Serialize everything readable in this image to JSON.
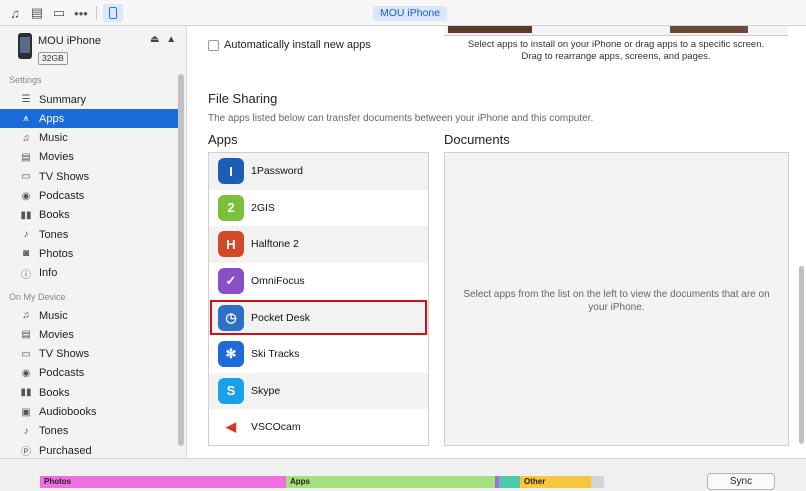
{
  "toolbar": {
    "icons": [
      "music-note-icon",
      "film-icon",
      "tv-icon",
      "more-icon",
      "iphone-icon"
    ],
    "more_label": "•••",
    "device_pill": "MOU iPhone"
  },
  "device": {
    "name": "MOU iPhone",
    "capacity": "32GB",
    "actions": "⏏ ▲"
  },
  "sidebar": {
    "settings_label": "Settings",
    "settings_items": [
      {
        "label": "Summary",
        "icon": "summary-icon",
        "glyph": "☰"
      },
      {
        "label": "Apps",
        "icon": "apps-icon",
        "glyph": "⩚"
      },
      {
        "label": "Music",
        "icon": "music-note-icon",
        "glyph": "♫"
      },
      {
        "label": "Movies",
        "icon": "film-icon",
        "glyph": "▤"
      },
      {
        "label": "TV Shows",
        "icon": "tv-icon",
        "glyph": "▭"
      },
      {
        "label": "Podcasts",
        "icon": "podcast-icon",
        "glyph": "◉"
      },
      {
        "label": "Books",
        "icon": "books-icon",
        "glyph": "▮▮"
      },
      {
        "label": "Tones",
        "icon": "bell-icon",
        "glyph": "♪"
      },
      {
        "label": "Photos",
        "icon": "camera-icon",
        "glyph": "◙"
      },
      {
        "label": "Info",
        "icon": "info-icon",
        "glyph": "ⓘ"
      }
    ],
    "ondevice_label": "On My Device",
    "device_items": [
      {
        "label": "Music",
        "icon": "music-note-icon",
        "glyph": "♫"
      },
      {
        "label": "Movies",
        "icon": "film-icon",
        "glyph": "▤"
      },
      {
        "label": "TV Shows",
        "icon": "tv-icon",
        "glyph": "▭"
      },
      {
        "label": "Podcasts",
        "icon": "podcast-icon",
        "glyph": "◉"
      },
      {
        "label": "Books",
        "icon": "books-icon",
        "glyph": "▮▮"
      },
      {
        "label": "Audiobooks",
        "icon": "audiobook-icon",
        "glyph": "▣"
      },
      {
        "label": "Tones",
        "icon": "bell-icon",
        "glyph": "♪"
      },
      {
        "label": "Purchased",
        "icon": "purchased-icon",
        "glyph": "Ⓟ"
      }
    ],
    "active_index": 1
  },
  "main": {
    "auto_install_label": "Automatically install new apps",
    "screens_hint_line1": "Select apps to install on your iPhone or drag apps to a specific screen.",
    "screens_hint_line2": "Drag to rearrange apps, screens, and pages.",
    "file_sharing_title": "File Sharing",
    "file_sharing_desc": "The apps listed below can transfer documents between your iPhone and this computer.",
    "apps_header": "Apps",
    "documents_header": "Documents",
    "apps": [
      {
        "name": "1Password",
        "icon": "1password-icon",
        "color": "#1d5eb5",
        "glyph": "I"
      },
      {
        "name": "2GIS",
        "icon": "2gis-icon",
        "color": "#7cbf3a",
        "glyph": "2"
      },
      {
        "name": "Halftone 2",
        "icon": "halftone-icon",
        "color": "#d24a28",
        "glyph": "H"
      },
      {
        "name": "OmniFocus",
        "icon": "omnifocus-icon",
        "color": "#8a4fc4",
        "glyph": "✓"
      },
      {
        "name": "Pocket Desk",
        "icon": "pocket-desk-icon",
        "color": "#2f6fc8",
        "glyph": "◷"
      },
      {
        "name": "Ski Tracks",
        "icon": "ski-tracks-icon",
        "color": "#1f6ad8",
        "glyph": "✻"
      },
      {
        "name": "Skype",
        "icon": "skype-icon",
        "color": "#19a0e6",
        "glyph": "S"
      },
      {
        "name": "VSCOcam",
        "icon": "vscocam-icon",
        "color": "#ffffff",
        "glyph": "◀"
      }
    ],
    "selected_index": 4,
    "documents_hint": "Select apps from the list on the left to view the documents that are on your iPhone."
  },
  "footer": {
    "storage": [
      {
        "label": "Photos",
        "color": "#ef6ee0",
        "share": 0.383
      },
      {
        "label": "Apps",
        "color": "#a4e07e",
        "share": 0.325
      },
      {
        "label": "",
        "color": "#a96ad8",
        "share": 0.005
      },
      {
        "label": "",
        "color": "#4ccaa9",
        "share": 0.033
      },
      {
        "label": "Other",
        "color": "#f6c63c",
        "share": 0.111
      },
      {
        "label": "",
        "color": "#d4d4d4",
        "share": 0.021
      }
    ],
    "sync_label": "Sync"
  }
}
